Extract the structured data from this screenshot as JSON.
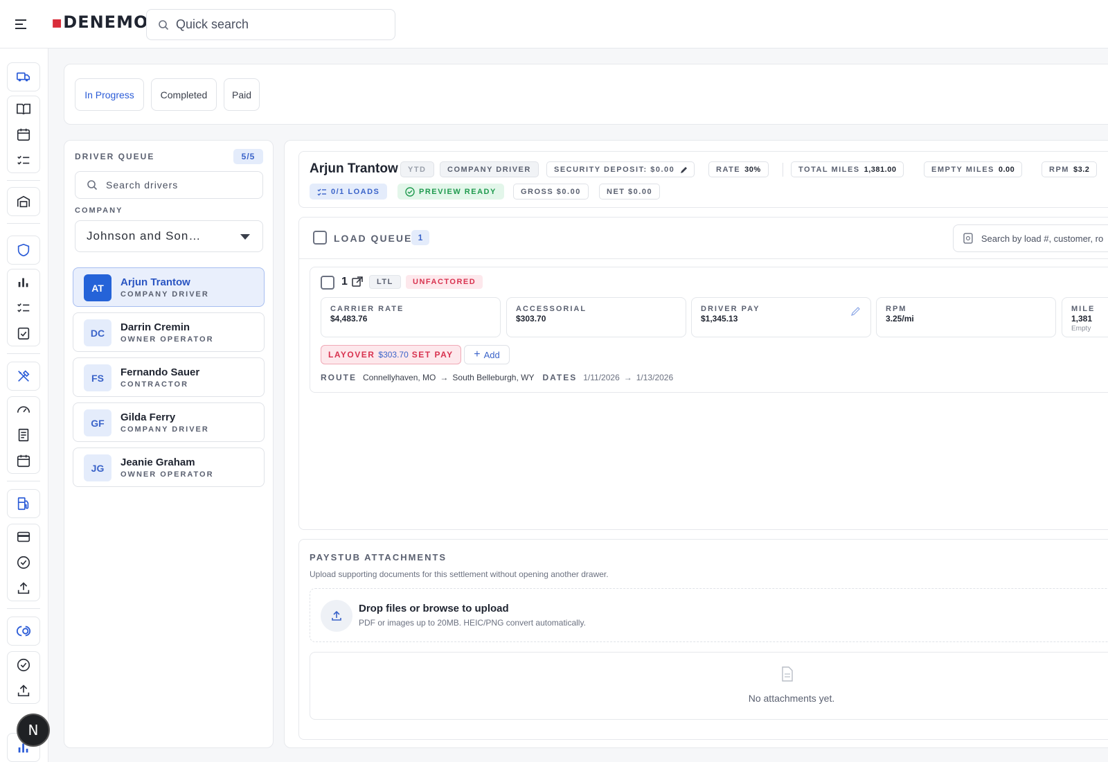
{
  "app": {
    "logo": "DENEMO"
  },
  "topbar": {
    "search_placeholder": "Quick search"
  },
  "sidebar": {
    "icons": [
      "truck-icon",
      "book-icon",
      "calendar-icon",
      "checklist-icon",
      "warehouse-icon",
      "shield-icon",
      "bar-chart-icon",
      "checklist-icon",
      "clipboard-check-icon",
      "tools-icon",
      "speedometer-icon",
      "receipt-icon",
      "calendar-icon",
      "fuel-icon",
      "credit-card-icon",
      "check-circle-icon",
      "upload-icon",
      "integration-icon",
      "check-circle-icon",
      "upload-icon",
      "bar-chart-icon"
    ],
    "user_initial": "N"
  },
  "tabs": [
    {
      "label": "In Progress",
      "active": true
    },
    {
      "label": "Completed",
      "active": false
    },
    {
      "label": "Paid",
      "active": false
    }
  ],
  "driver_queue": {
    "title": "DRIVER QUEUE",
    "count": "5/5",
    "search_placeholder": "Search drivers",
    "company_label": "COMPANY",
    "company_value": "Johnson and Son…",
    "drivers": [
      {
        "initials": "AT",
        "name": "Arjun Trantow",
        "role": "COMPANY DRIVER",
        "selected": true
      },
      {
        "initials": "DC",
        "name": "Darrin Cremin",
        "role": "OWNER OPERATOR",
        "selected": false
      },
      {
        "initials": "FS",
        "name": "Fernando Sauer",
        "role": "CONTRACTOR",
        "selected": false
      },
      {
        "initials": "GF",
        "name": "Gilda Ferry",
        "role": "COMPANY DRIVER",
        "selected": false
      },
      {
        "initials": "JG",
        "name": "Jeanie Graham",
        "role": "OWNER OPERATOR",
        "selected": false
      }
    ]
  },
  "summary": {
    "driver_name": "Arjun Trantow",
    "ytd": "YTD",
    "driver_type": "COMPANY DRIVER",
    "security_deposit_label": "SECURITY DEPOSIT: $0.00",
    "rate_label": "RATE",
    "rate_value": "30%",
    "total_miles_label": "TOTAL MILES",
    "total_miles_value": "1,381.00",
    "empty_miles_label": "EMPTY MILES",
    "empty_miles_value": "0.00",
    "rpm_label": "RPM",
    "rpm_value": "$3.2",
    "loads": "0/1 LOADS",
    "preview": "PREVIEW READY",
    "gross": "GROSS $0.00",
    "net": "NET $0.00"
  },
  "load_queue": {
    "title": "LOAD QUEUE",
    "count": "1",
    "search_placeholder": "Search by load #, customer, ro",
    "load": {
      "number": "1",
      "type_tag": "LTL",
      "status_tag": "UNFACTORED",
      "metrics": [
        {
          "label": "CARRIER RATE",
          "value": "$4,483.76",
          "sub": ""
        },
        {
          "label": "ACCESSORIAL",
          "value": "$303.70",
          "sub": ""
        },
        {
          "label": "DRIVER PAY",
          "value": "$1,345.13",
          "sub": ""
        },
        {
          "label": "RPM",
          "value": "3.25/mi",
          "sub": ""
        },
        {
          "label": "MILE",
          "value": "1,381",
          "sub": "Empty"
        }
      ],
      "layover_label": "LAYOVER",
      "layover_amount": "$303.70",
      "layover_action": "SET PAY",
      "add_label": "Add",
      "route_label": "ROUTE",
      "route_from": "Connellyhaven, MO",
      "route_to": "South Belleburgh, WY",
      "dates_label": "DATES",
      "date_from": "1/11/2026",
      "date_to": "1/13/2026",
      "arrow": "→"
    }
  },
  "attachments": {
    "title": "PAYSTUB ATTACHMENTS",
    "description": "Upload supporting documents for this settlement without opening another drawer.",
    "drop_title": "Drop files or browse to upload",
    "drop_sub": "PDF or images up to 20MB. HEIC/PNG convert automatically.",
    "empty_text": "No attachments yet."
  },
  "colors": {
    "accent": "#2563d8",
    "danger": "#d8324f",
    "success": "#1f9a4e"
  }
}
